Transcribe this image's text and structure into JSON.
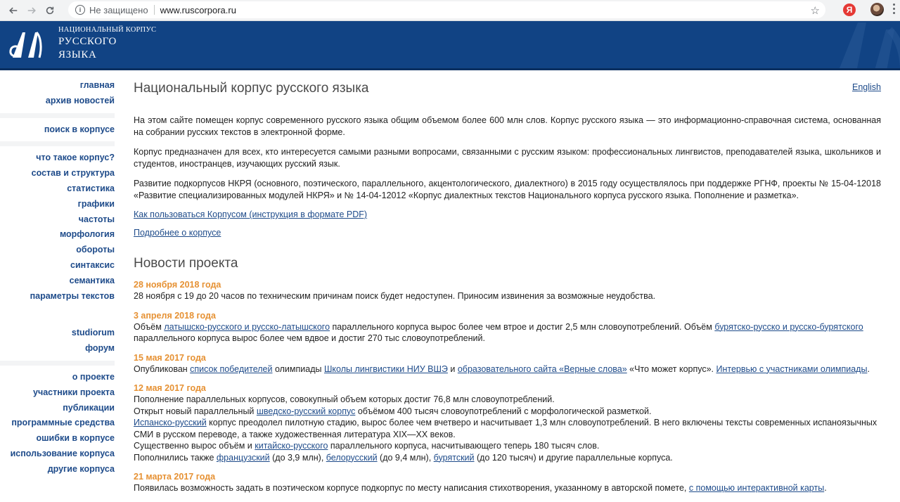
{
  "browser": {
    "security_label": "Не защищено",
    "url": "www.ruscorpora.ru",
    "ext_letter": "Я"
  },
  "header": {
    "small_title": "НАЦИОНАЛЬНЫЙ КОРПУС",
    "big_line1": "РУССКОГО",
    "big_line2": "ЯЗЫКА",
    "accent_color": "#114384"
  },
  "sidebar": {
    "group1": [
      "главная",
      "архив новостей"
    ],
    "group2": [
      "поиск в корпусе"
    ],
    "group3": [
      "что такое корпус?",
      "состав и структура",
      "статистика",
      "графики",
      "частоты",
      "морфология",
      "обороты",
      "синтаксис",
      "семантика",
      "параметры текстов"
    ],
    "group4": [
      "studiorum",
      "форум"
    ],
    "group5": [
      "о проекте",
      "участники проекта",
      "публикации",
      "программные средства",
      "ошибки в корпусе",
      "использование корпуса",
      "другие корпуса"
    ]
  },
  "main": {
    "title": "Национальный корпус русского языка",
    "english_link": "English",
    "p1": "На этом сайте помещен корпус современного русского языка общим объемом более 600 млн слов. Корпус русского языка — это информационно-справочная система, основанная на собрании русских текстов в электронной форме.",
    "p2": "Корпус предназначен для всех, кто интересуется самыми разными вопросами, связанными с русским языком: профессиональных лингвистов, преподавателей языка, школьников и студентов, иностранцев, изучающих русский язык.",
    "p3": "Развитие подкорпусов НКРЯ (основного, поэтического, параллельного, акцентологического, диалектного) в 2015 году осуществлялось при поддержке РГНФ, проекты № 15-04-12018 «Развитие специализированных модулей НКРЯ» и № 14-04-12012 «Корпус диалектных текстов Национального корпуса русского языка. Пополнение и разметка».",
    "link_howto": "Как пользоваться Корпусом (инструкция в формате PDF)",
    "link_more": "Подробнее о корпусе",
    "news_title": "Новости проекта"
  },
  "news": {
    "n1": {
      "date": "28 ноября 2018 года",
      "text": "28 ноября с 19 до 20 часов по техническим причинам поиск будет недоступен. Приносим извинения за возможные неудобства."
    },
    "n2": {
      "date": "3 апреля 2018 года",
      "t1": "Объём ",
      "l1": "латышско-русского и русско-латышского",
      "t2": " параллельного корпуса вырос более чем втрое и достиг 2,5 млн словоупотреблений. Объём ",
      "l2": "бурятско-русско и русско-бурятского",
      "t3": "параллельного корпуса вырос более чем вдвое и достиг 270 тыс словоупотреблений."
    },
    "n3": {
      "date": "15 мая 2017 года",
      "t1": "Опубликован ",
      "l1": "список победителей",
      "t2": " олимпиады ",
      "l2": "Школы лингвистики НИУ ВШЭ",
      "t3": " и ",
      "l3": "образовательного сайта «Верные слова»",
      "t4": " «Что может корпус». ",
      "l4": "Интервью с участниками олимпиады",
      "t5": "."
    },
    "n4": {
      "date": "12 мая 2017 года",
      "line1": "Пополнение параллельных корпусов, совокупный объем которых достиг 76,8 млн словоупотреблений.",
      "l2a": "Открыт новый параллельный ",
      "l2link": "шведско-русский корпус",
      "l2b": " объёмом 400 тысяч словоупотреблений с морфологической разметкой.",
      "l3link": "Испанско-русский",
      "l3a": " корпус преодолел пилотную стадию, вырос более чем вчетверо и насчитывает 1,3 млн словоупотреблений. В него включены тексты современных испаноязычных",
      "l3b": "СМИ в русском переводе, а также художественная литература XIX—XX веков.",
      "l4a": "Существенно вырос объём и ",
      "l4link": "китайско-русского",
      "l4b": " параллельного корпуса, насчитывающего теперь 180 тысяч слов.",
      "l5a": "Пополнились также ",
      "l5link1": "французский",
      "l5b": " (до 3,9 млн), ",
      "l5link2": "белорусский",
      "l5c": " (до 9,4 млн), ",
      "l5link3": "бурятский",
      "l5d": " (до 120 тысяч) и другие параллельные корпуса."
    },
    "n5": {
      "date": "21 марта 2017 года",
      "t1": "Появилась возможность задать в поэтическом корпусе подкорпус по месту написания стихотворения, указанному в авторской помете, ",
      "l1": "с помощью интерактивной карты",
      "t2": "."
    }
  }
}
